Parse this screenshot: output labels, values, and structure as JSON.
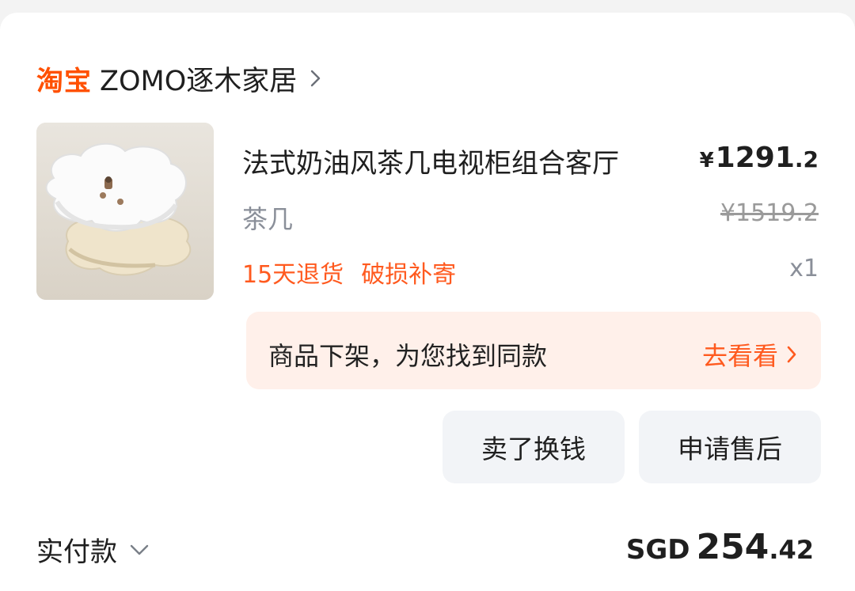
{
  "shop": {
    "platform_logo": "淘宝",
    "name": "ZOMO逐木家居"
  },
  "item": {
    "title": "法式奶油风茶几电视柜组合客厅",
    "spec": "茶几",
    "price_currency": "¥",
    "price_integer": "1291",
    "price_decimal": ".2",
    "original_price": "¥1519.2",
    "quantity": "x1",
    "tags": [
      "15天退货",
      "破损补寄"
    ],
    "image_alt": "cream flower-shaped coffee table"
  },
  "notice": {
    "text": "商品下架，为您找到同款",
    "link_label": "去看看"
  },
  "actions": {
    "sell_label": "卖了换钱",
    "aftersale_label": "申请售后"
  },
  "payment": {
    "label": "实付款",
    "currency": "SGD",
    "amount_integer": "254",
    "amount_decimal": ".42"
  },
  "colors": {
    "brand_orange": "#ff5000",
    "accent": "#ff5a1f",
    "notice_bg": "#fff0ea",
    "button_bg": "#f2f4f7",
    "muted_text": "#8a8f99"
  },
  "icons": {
    "shop_chevron": "chevron-right-icon",
    "notice_chevron": "chevron-right-icon",
    "payment_toggle": "chevron-down-icon"
  }
}
